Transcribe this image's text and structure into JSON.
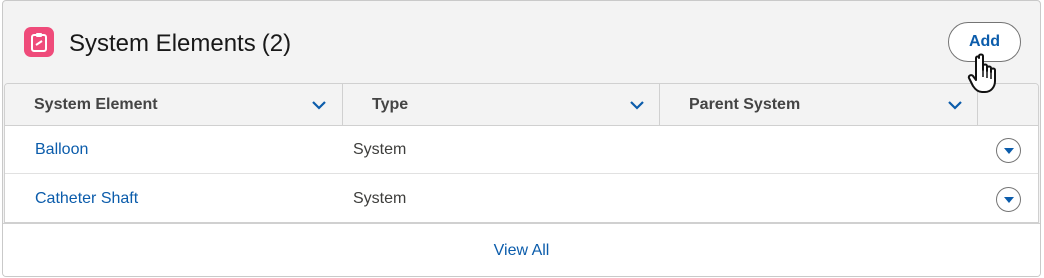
{
  "header": {
    "icon": "clipboard-icon",
    "title": "System Elements",
    "count": "(2)",
    "add_label": "Add"
  },
  "colors": {
    "accent": "#0b5cab",
    "icon_bg": "#ef4b7a",
    "header_bg": "#f3f3f3",
    "border": "#c9c9c9"
  },
  "table": {
    "columns": [
      {
        "label": "System Element",
        "icon": "chevron-down-icon"
      },
      {
        "label": "Type",
        "icon": "chevron-down-icon"
      },
      {
        "label": "Parent System",
        "icon": "chevron-down-icon"
      }
    ],
    "rows": [
      {
        "system_element": "Balloon",
        "type": "System",
        "parent_system": "",
        "action_icon": "caret-down-circle-icon"
      },
      {
        "system_element": "Catheter Shaft",
        "type": "System",
        "parent_system": "",
        "action_icon": "caret-down-circle-icon"
      }
    ]
  },
  "footer": {
    "view_all_label": "View All"
  },
  "cursor_icon": "hand-pointer-icon"
}
